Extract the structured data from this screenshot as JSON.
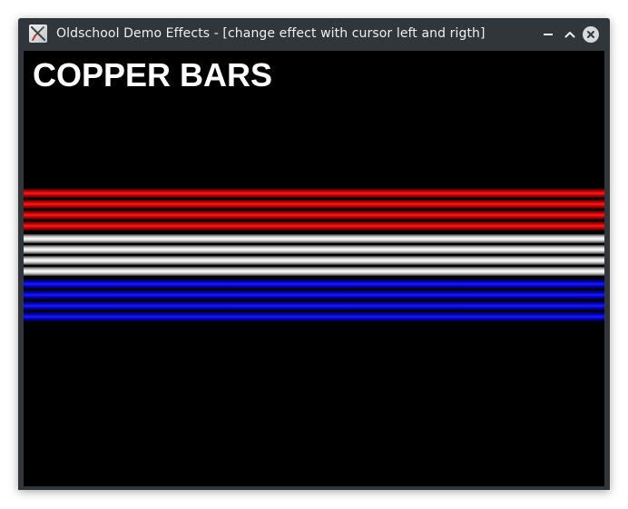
{
  "window": {
    "title": "Oldschool Demo Effects - [change effect with cursor left and rigth]",
    "app_icon": "x-window-icon",
    "controls": [
      "minimize-icon",
      "maximize-icon",
      "close-icon"
    ]
  },
  "effect": {
    "name": "COPPER BARS",
    "bars": [
      {
        "color": "red",
        "base_hex": "#ff1a1a"
      },
      {
        "color": "red",
        "base_hex": "#ff1a1a"
      },
      {
        "color": "red",
        "base_hex": "#ff1a1a"
      },
      {
        "color": "red",
        "base_hex": "#ff1a1a"
      },
      {
        "color": "white",
        "base_hex": "#ffffff"
      },
      {
        "color": "white",
        "base_hex": "#ffffff"
      },
      {
        "color": "white",
        "base_hex": "#ffffff"
      },
      {
        "color": "white",
        "base_hex": "#ffffff"
      },
      {
        "color": "blue",
        "base_hex": "#1a1aff"
      },
      {
        "color": "blue",
        "base_hex": "#1a1aff"
      },
      {
        "color": "blue",
        "base_hex": "#1a1aff"
      },
      {
        "color": "blue",
        "base_hex": "#1a1aff"
      }
    ]
  },
  "colors": {
    "titlebar_bg": "#31363b",
    "titlebar_text": "#eff0f1",
    "canvas_bg": "#000000"
  }
}
